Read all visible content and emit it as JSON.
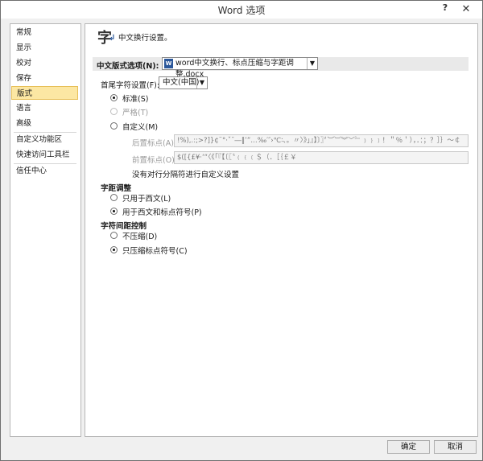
{
  "window": {
    "title": "Word 选项",
    "help": "?",
    "close": "✕"
  },
  "sidebar": {
    "items": [
      "常规",
      "显示",
      "校对",
      "保存",
      "版式",
      "语言",
      "高级",
      "自定义功能区",
      "快速访问工具栏",
      "信任中心"
    ],
    "selected": "版式"
  },
  "header": {
    "icon_glyph": "字",
    "icon_arrow": "↲",
    "text": "中文换行设置。"
  },
  "options_for": {
    "label": "中文版式选项(N):",
    "value": "word中文换行、标点压缩与字距调整.docx"
  },
  "first_last": {
    "label": "首尾字符设置(F):",
    "value": "中文(中国)"
  },
  "levels": [
    {
      "label": "标准(S)",
      "checked": true,
      "disabled": false
    },
    {
      "label": "严格(T)",
      "checked": false,
      "disabled": true
    },
    {
      "label": "自定义(M)",
      "checked": false,
      "disabled": false
    }
  ],
  "no_follow": {
    "label": "后置标点(A):",
    "value": "!%),.:;>?]}¢¨°·ˇˉ―‖’”…‰′″›℃∶、。〃〉》」』】〕〗〞︶︺︾﹀﹄﹚﹜﹞！＂％＇），．：；？］｝～￠"
  },
  "no_lead": {
    "label": "前置标点(O):",
    "value": "$([{£¥·‘“〈《「『【〔〖〝﹙﹛﹝＄（．［｛￡￥"
  },
  "note": "没有对行分隔符进行自定义设置",
  "spacing": {
    "title": "字距调整",
    "options": [
      {
        "label": "只用于西文(L)",
        "checked": false
      },
      {
        "label": "用于西文和标点符号(P)",
        "checked": true
      }
    ]
  },
  "compression": {
    "title": "字符间距控制",
    "options": [
      {
        "label": "不压缩(D)",
        "checked": false
      },
      {
        "label": "只压缩标点符号(C)",
        "checked": true
      }
    ]
  },
  "buttons": {
    "ok": "确定",
    "cancel": "取消"
  },
  "colors": {
    "selected_bg": "#fce7a3",
    "accent": "#2b579a"
  }
}
